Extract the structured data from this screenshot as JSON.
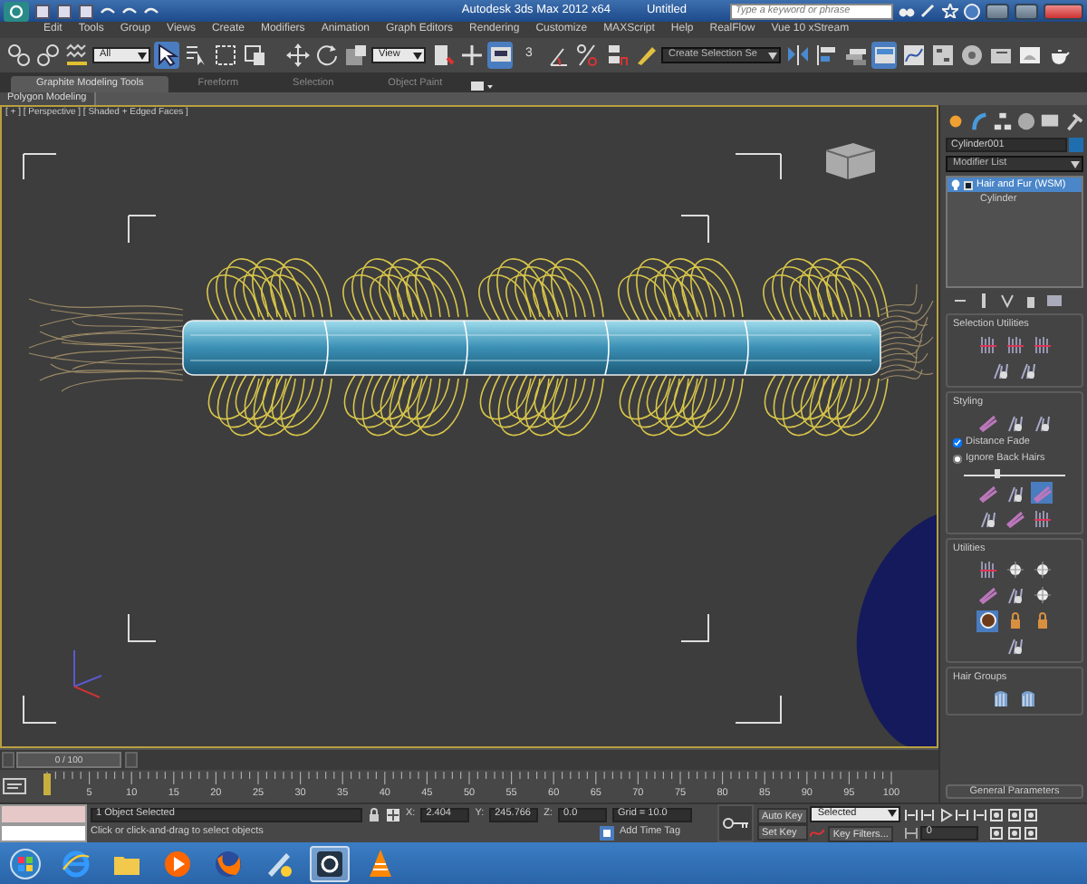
{
  "window": {
    "title": "Autodesk 3ds Max 2012 x64",
    "document": "Untitled"
  },
  "search": {
    "placeholder": "Type a keyword or phrase"
  },
  "menu": [
    "Edit",
    "Tools",
    "Group",
    "Views",
    "Create",
    "Modifiers",
    "Animation",
    "Graph Editors",
    "Rendering",
    "Customize",
    "MAXScript",
    "Help",
    "RealFlow",
    "Vue 10 xStream"
  ],
  "toolbar": {
    "selection_filter": "All",
    "reference_coordinate_system": "View",
    "snaps_toggle": "3",
    "named_selection_set": "Create Selection Se"
  },
  "ribbon": {
    "tabs": [
      {
        "label": "Graphite Modeling Tools",
        "selected": true
      },
      {
        "label": "Freeform",
        "selected": false
      },
      {
        "label": "Selection",
        "selected": false
      },
      {
        "label": "Object Paint",
        "selected": false
      }
    ],
    "panel_label": "Polygon Modeling"
  },
  "viewport": {
    "label": "[ + ] [ Perspective ] [ Shaded + Edged Faces ]",
    "active": true
  },
  "command_panel": {
    "object_name": "Cylinder001",
    "modifier_list": "Modifier List",
    "stack": [
      {
        "label": "Hair and Fur (WSM)",
        "selected": true
      },
      {
        "label": "Cylinder",
        "selected": false
      }
    ],
    "rollouts": [
      {
        "kind": "selection_utilities",
        "title": "Selection Utilities"
      },
      {
        "kind": "styling",
        "title": "Styling",
        "options": [
          {
            "label": "Distance Fade",
            "checked": true
          },
          {
            "label": "Ignore Back Hairs",
            "checked": false
          }
        ],
        "level": 0.3
      },
      {
        "kind": "utilities",
        "title": "Utilities"
      },
      {
        "kind": "hair_groups",
        "title": "Hair Groups"
      }
    ],
    "collapsed_rollout": "General Parameters"
  },
  "timeline": {
    "position": "0 / 100",
    "level": 0,
    "tick_labels": [
      "5",
      "10",
      "15",
      "20",
      "25",
      "30",
      "35",
      "40",
      "45",
      "50",
      "55",
      "60",
      "65",
      "70",
      "75",
      "80",
      "85",
      "90",
      "95",
      "100"
    ]
  },
  "status": {
    "selection": "1 Object Selected",
    "prompt": "Click or click-and-drag to select objects",
    "coordinates": [
      {
        "axis": "X:",
        "value": "2.404"
      },
      {
        "axis": "Y:",
        "value": "245.766"
      },
      {
        "axis": "Z:",
        "value": "0.0"
      }
    ],
    "grid": "Grid = 10.0",
    "time_tag": "Add Time Tag"
  },
  "animation": {
    "auto_key": "Auto Key",
    "set_key": "Set Key",
    "key_mode": "Selected",
    "key_filters": "Key Filters...",
    "current_frame": "0"
  },
  "taskbar": [
    {
      "kind": "start",
      "selected": false
    },
    {
      "kind": "browser",
      "selected": false
    },
    {
      "kind": "folder",
      "selected": false
    },
    {
      "kind": "media",
      "selected": false
    },
    {
      "kind": "firefox",
      "selected": false
    },
    {
      "kind": "paint",
      "selected": false
    },
    {
      "kind": "max",
      "selected": true
    },
    {
      "kind": "vlc",
      "selected": false
    }
  ]
}
